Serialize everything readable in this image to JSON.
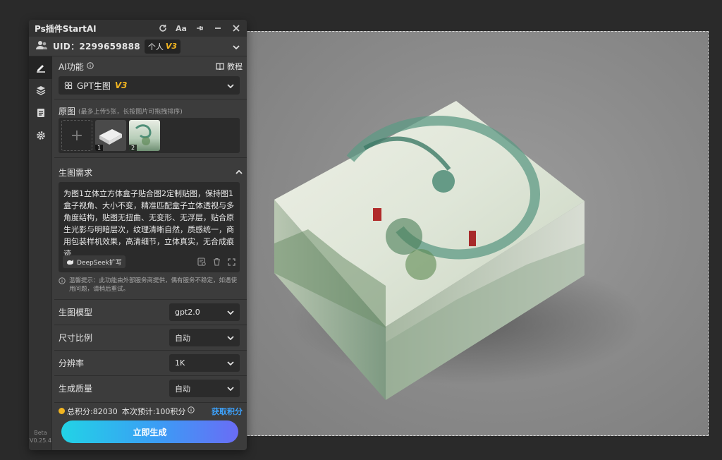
{
  "window": {
    "title": "Ps插件StartAI"
  },
  "titlebar_icons": [
    "refresh-icon",
    "font-icon",
    "pin-icon",
    "minimize-icon",
    "close-icon"
  ],
  "font_icon_label": "Aa",
  "user": {
    "uid": "UID：2299659888",
    "plan": "个人",
    "version": "V3"
  },
  "ai_function": {
    "label": "AI功能",
    "tutorial": "教程",
    "selected": "GPT生图",
    "version": "V3"
  },
  "source_images": {
    "label": "原图",
    "hint": "(最多上传5张，长按图片可拖拽排序)",
    "add_symbol": "+",
    "thumbnails": [
      {
        "num": "1"
      },
      {
        "num": "2"
      }
    ]
  },
  "prompt": {
    "label": "生图需求",
    "text": "为图1立体立方体盒子贴合图2定制贴图，保持图1盒子视角、大小不变，精准匹配盒子立体透视与多角度结构，贴图无扭曲、无变形、无浮层，贴合原生光影与明暗层次，纹理清晰自然，质感统一，商用包装样机效果，高清细节，立体真实，无合成痕迹",
    "deepseek_btn": "DeepSeek扩写"
  },
  "notice": "温馨提示：此功能由外部服务商提供，偶有服务不稳定，如遇使用问题，请稍后重试。",
  "settings": [
    {
      "label": "生图模型",
      "value": "gpt2.0"
    },
    {
      "label": "尺寸比例",
      "value": "自动"
    },
    {
      "label": "分辨率",
      "value": "1K"
    },
    {
      "label": "生成质量",
      "value": "自动"
    }
  ],
  "credits": {
    "total": "总积分:82030",
    "estimate": "本次预计:100积分",
    "get": "获取积分"
  },
  "generate_btn": "立即生成",
  "footer": {
    "beta": "Beta",
    "version": "V0.25.4"
  },
  "colors": {
    "accent": "#3da3ff",
    "gold": "#f2b521",
    "panel": "#3c3c3c"
  }
}
